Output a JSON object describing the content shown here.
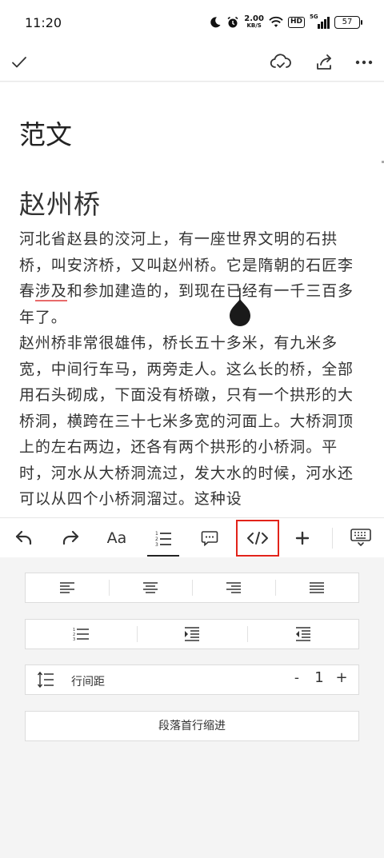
{
  "status": {
    "time": "11:20",
    "net_speed_value": "2.00",
    "net_speed_unit": "KB/S",
    "hd_label": "HD",
    "signal_label": "5G",
    "battery": "57"
  },
  "topbar": {
    "icons": [
      "check-icon",
      "cloud-sync-icon",
      "share-icon",
      "more-icon"
    ]
  },
  "document": {
    "title": "范文",
    "heading": "赵州桥",
    "p1_a": "河北省赵县的洨河上，有一座世界文明的石拱桥，叫安济桥，又叫赵州桥。它是隋朝的石匠李春",
    "p1_underlined": "涉及",
    "p1_b": "和参加建造的，到现在已经有一千三百多年了。",
    "p2": "赵州桥非常很雄伟，桥长五十多米，有九米多宽，中间行车马，两旁走人。这么长的桥，全部用石头砌成，下面没有桥礅，只有一个拱形的大桥洞，横跨在三十七米多宽的河面上。大桥洞顶上的左右两边，还各有两个拱形的小桥洞。平时，河水从大桥洞流过，发大水的时候，河水还可以从四个小桥洞溜过。这种设"
  },
  "toolbar": {
    "font_label": "Aa",
    "active_tab": "paragraph",
    "highlighted_tool": "code"
  },
  "panel": {
    "align_options": [
      "align-left",
      "align-center",
      "align-right",
      "align-justify"
    ],
    "list_options": [
      "numbered-list",
      "increase-indent",
      "decrease-indent"
    ],
    "line_spacing_label": "行间距",
    "line_spacing_minus": "-",
    "line_spacing_value": "1",
    "line_spacing_plus": "+",
    "first_line_indent_label": "段落首行缩进"
  },
  "colors": {
    "highlight_border": "#e2231a",
    "underline": "#e86a6a"
  }
}
